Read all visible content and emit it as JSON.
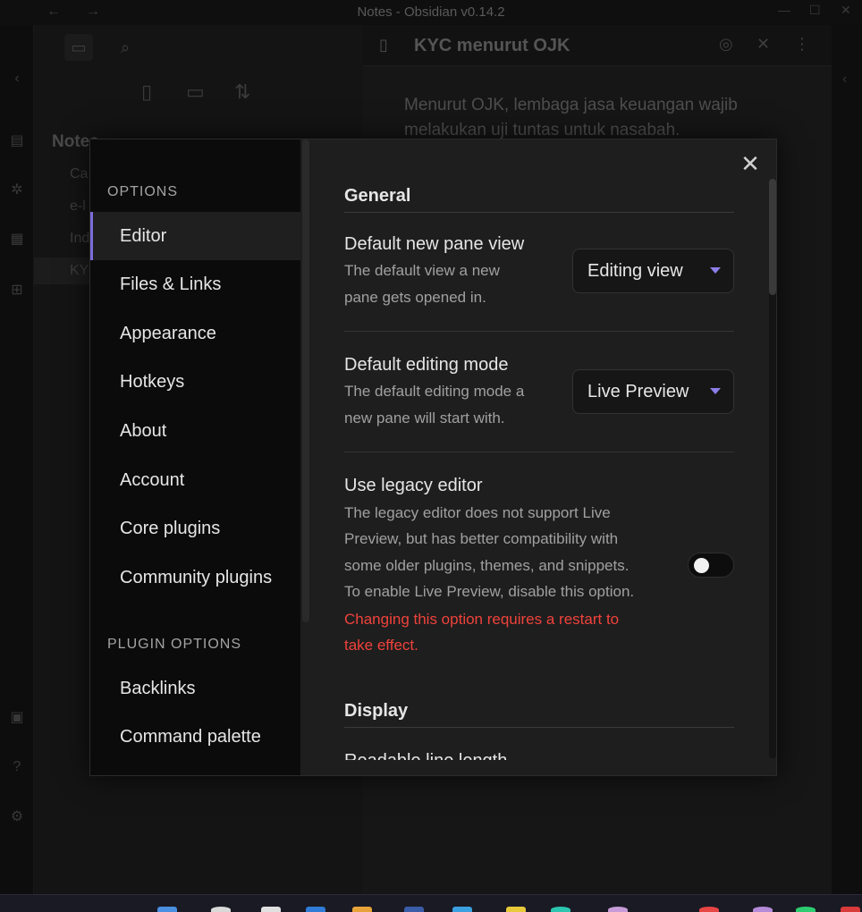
{
  "window": {
    "title": "Notes - Obsidian v0.14.2",
    "back_icon": "←",
    "forward_icon": "→"
  },
  "sidebar_bg": {
    "vault_title": "Notes",
    "files": [
      "Ca",
      "e-l",
      "Ind",
      "KY"
    ]
  },
  "editor_bg": {
    "doc_title": "KYC menurut OJK",
    "body": "Menurut OJK, lembaga jasa keuangan wajib melakukan uji tuntas untuk nasabah."
  },
  "settings_sidebar": {
    "options_heading": "OPTIONS",
    "items": [
      {
        "label": "Editor"
      },
      {
        "label": "Files & Links"
      },
      {
        "label": "Appearance"
      },
      {
        "label": "Hotkeys"
      },
      {
        "label": "About"
      },
      {
        "label": "Account"
      },
      {
        "label": "Core plugins"
      },
      {
        "label": "Community plugins"
      }
    ],
    "plugin_heading": "PLUGIN OPTIONS",
    "plugin_items": [
      {
        "label": "Backlinks"
      },
      {
        "label": "Command palette"
      }
    ]
  },
  "settings": {
    "close_icon": "✕",
    "general_title": "General",
    "pane_view": {
      "name": "Default new pane view",
      "desc_1": "The default view a new",
      "desc_2": "pane gets opened in.",
      "value": "Editing view"
    },
    "editing_mode": {
      "name": "Default editing mode",
      "desc_1": "The default editing mode a",
      "desc_2": "new pane will start with.",
      "value": "Live Preview"
    },
    "legacy_editor": {
      "name": "Use legacy editor",
      "desc_1": "The legacy editor does not support Live",
      "desc_2": "Preview, but has better compatibility with",
      "desc_3": "some older plugins, themes, and snippets.",
      "desc_4": "To enable Live Preview, disable this option.",
      "warning_1": "Changing this option requires a restart to",
      "warning_2": "take effect.",
      "enabled": false
    },
    "display_title": "Display",
    "readable_line_length": "Readable line length"
  },
  "colors": {
    "accent": "#7b6cd9",
    "warning": "#f0423b"
  }
}
